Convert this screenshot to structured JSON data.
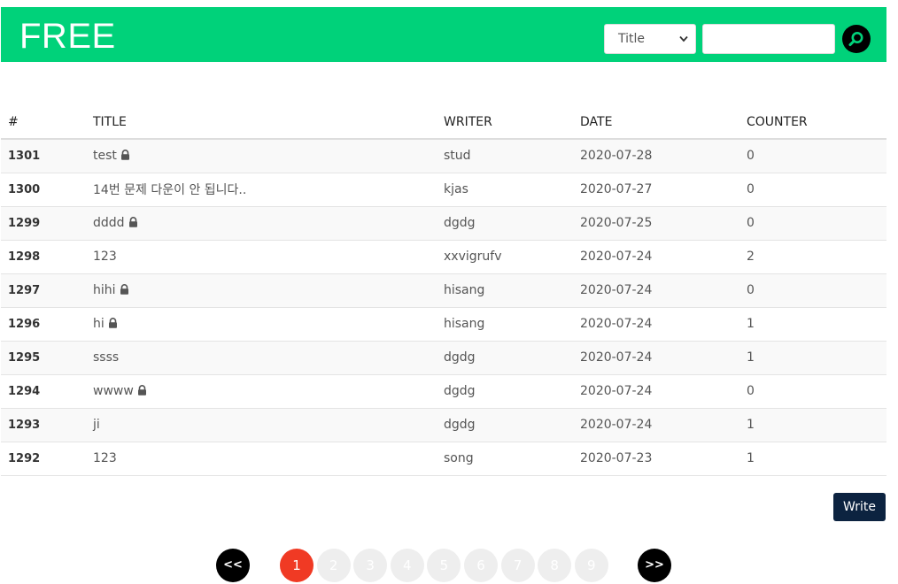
{
  "header": {
    "title": "FREE",
    "search_select_value": "Title",
    "search_input_value": "",
    "search_input_placeholder": ""
  },
  "table": {
    "columns": [
      "#",
      "TITLE",
      "WRITER",
      "DATE",
      "COUNTER"
    ],
    "rows": [
      {
        "num": "1301",
        "title": "test",
        "locked": true,
        "writer": "stud",
        "date": "2020-07-28",
        "counter": "0"
      },
      {
        "num": "1300",
        "title": "14번 문제 다운이 안 됩니다..",
        "locked": false,
        "writer": "kjas",
        "date": "2020-07-27",
        "counter": "0"
      },
      {
        "num": "1299",
        "title": "dddd",
        "locked": true,
        "writer": "dgdg",
        "date": "2020-07-25",
        "counter": "0"
      },
      {
        "num": "1298",
        "title": "123",
        "locked": false,
        "writer": "xxvigrufv",
        "date": "2020-07-24",
        "counter": "2"
      },
      {
        "num": "1297",
        "title": "hihi",
        "locked": true,
        "writer": "hisang",
        "date": "2020-07-24",
        "counter": "0"
      },
      {
        "num": "1296",
        "title": "hi",
        "locked": true,
        "writer": "hisang",
        "date": "2020-07-24",
        "counter": "1"
      },
      {
        "num": "1295",
        "title": "ssss",
        "locked": false,
        "writer": "dgdg",
        "date": "2020-07-24",
        "counter": "1"
      },
      {
        "num": "1294",
        "title": "wwww",
        "locked": true,
        "writer": "dgdg",
        "date": "2020-07-24",
        "counter": "0"
      },
      {
        "num": "1293",
        "title": "ji",
        "locked": false,
        "writer": "dgdg",
        "date": "2020-07-24",
        "counter": "1"
      },
      {
        "num": "1292",
        "title": "123",
        "locked": false,
        "writer": "song",
        "date": "2020-07-23",
        "counter": "1"
      }
    ]
  },
  "write_label": "Write",
  "pagination": {
    "prev_label": "<<",
    "next_label": ">>",
    "pages": [
      "1",
      "2",
      "3",
      "4",
      "5",
      "6",
      "7",
      "8",
      "9"
    ],
    "active_page": "1"
  },
  "colors": {
    "header_bg": "#00d27a",
    "write_button": "#0c2340",
    "active_page": "#f03a24"
  },
  "icons": {
    "search": "search-icon",
    "lock": "lock-icon",
    "select_chevron": "chevron-down-icon"
  }
}
